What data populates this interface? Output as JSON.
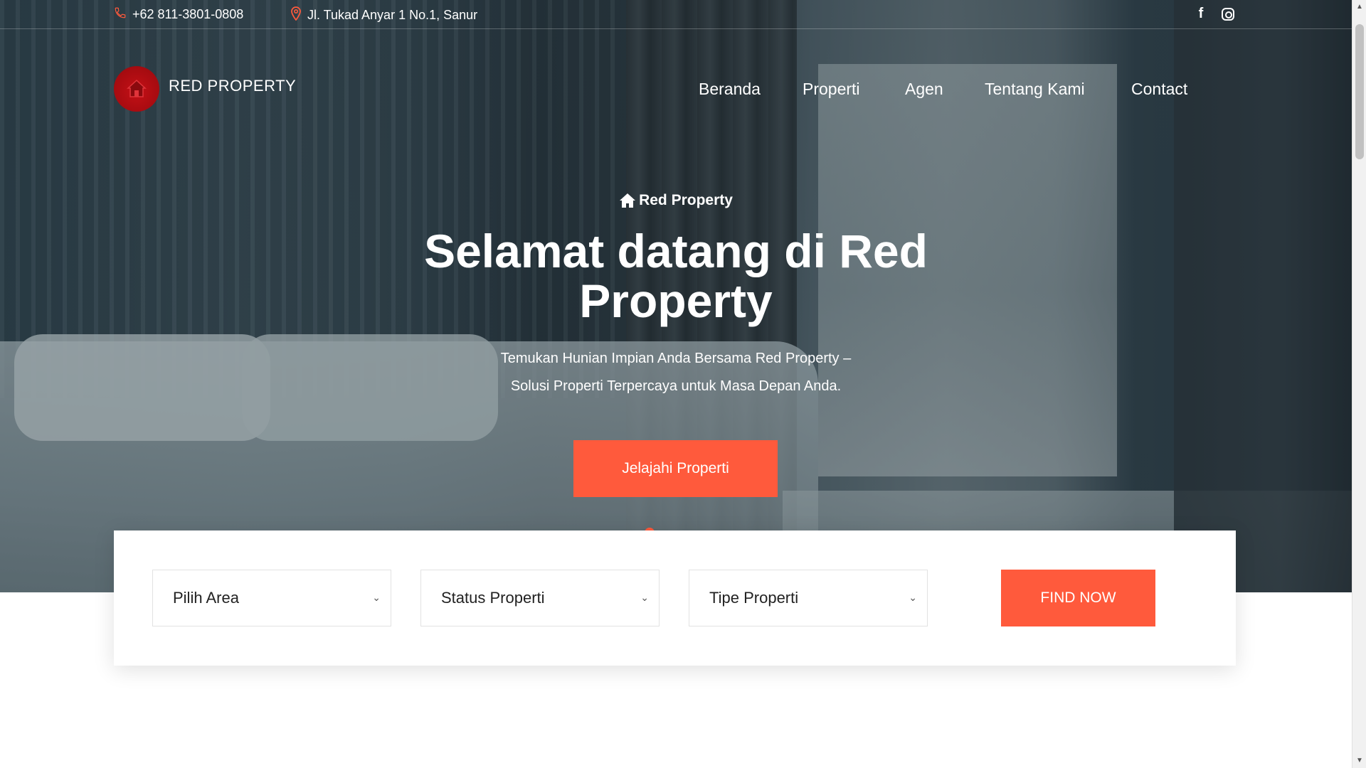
{
  "topbar": {
    "phone": "+62 811-3801-0808",
    "address": "Jl. Tukad Anyar 1 No.1, Sanur",
    "social": [
      "facebook-icon",
      "instagram-icon"
    ]
  },
  "brand": {
    "name": "RED PROPERTY",
    "logo_color": "#c41016"
  },
  "nav": {
    "items": [
      "Beranda",
      "Properti",
      "Agen",
      "Tentang Kami",
      "Contact"
    ]
  },
  "hero": {
    "eyebrow": "Red Property",
    "headline_line1": "Selamat datang di Red",
    "headline_line2": "Property",
    "sub_line1": "Temukan Hunian Impian Anda Bersama Red Property –",
    "sub_line2": "Solusi Properti Terpercaya untuk Masa Depan Anda.",
    "cta": "Jelajahi Properti"
  },
  "search": {
    "fields": [
      "Pilih Area",
      "Status Properti",
      "Tipe Properti"
    ],
    "button": "FIND NOW"
  },
  "colors": {
    "accent": "#ff5a3c",
    "text_on_dark": "#ffffff"
  }
}
